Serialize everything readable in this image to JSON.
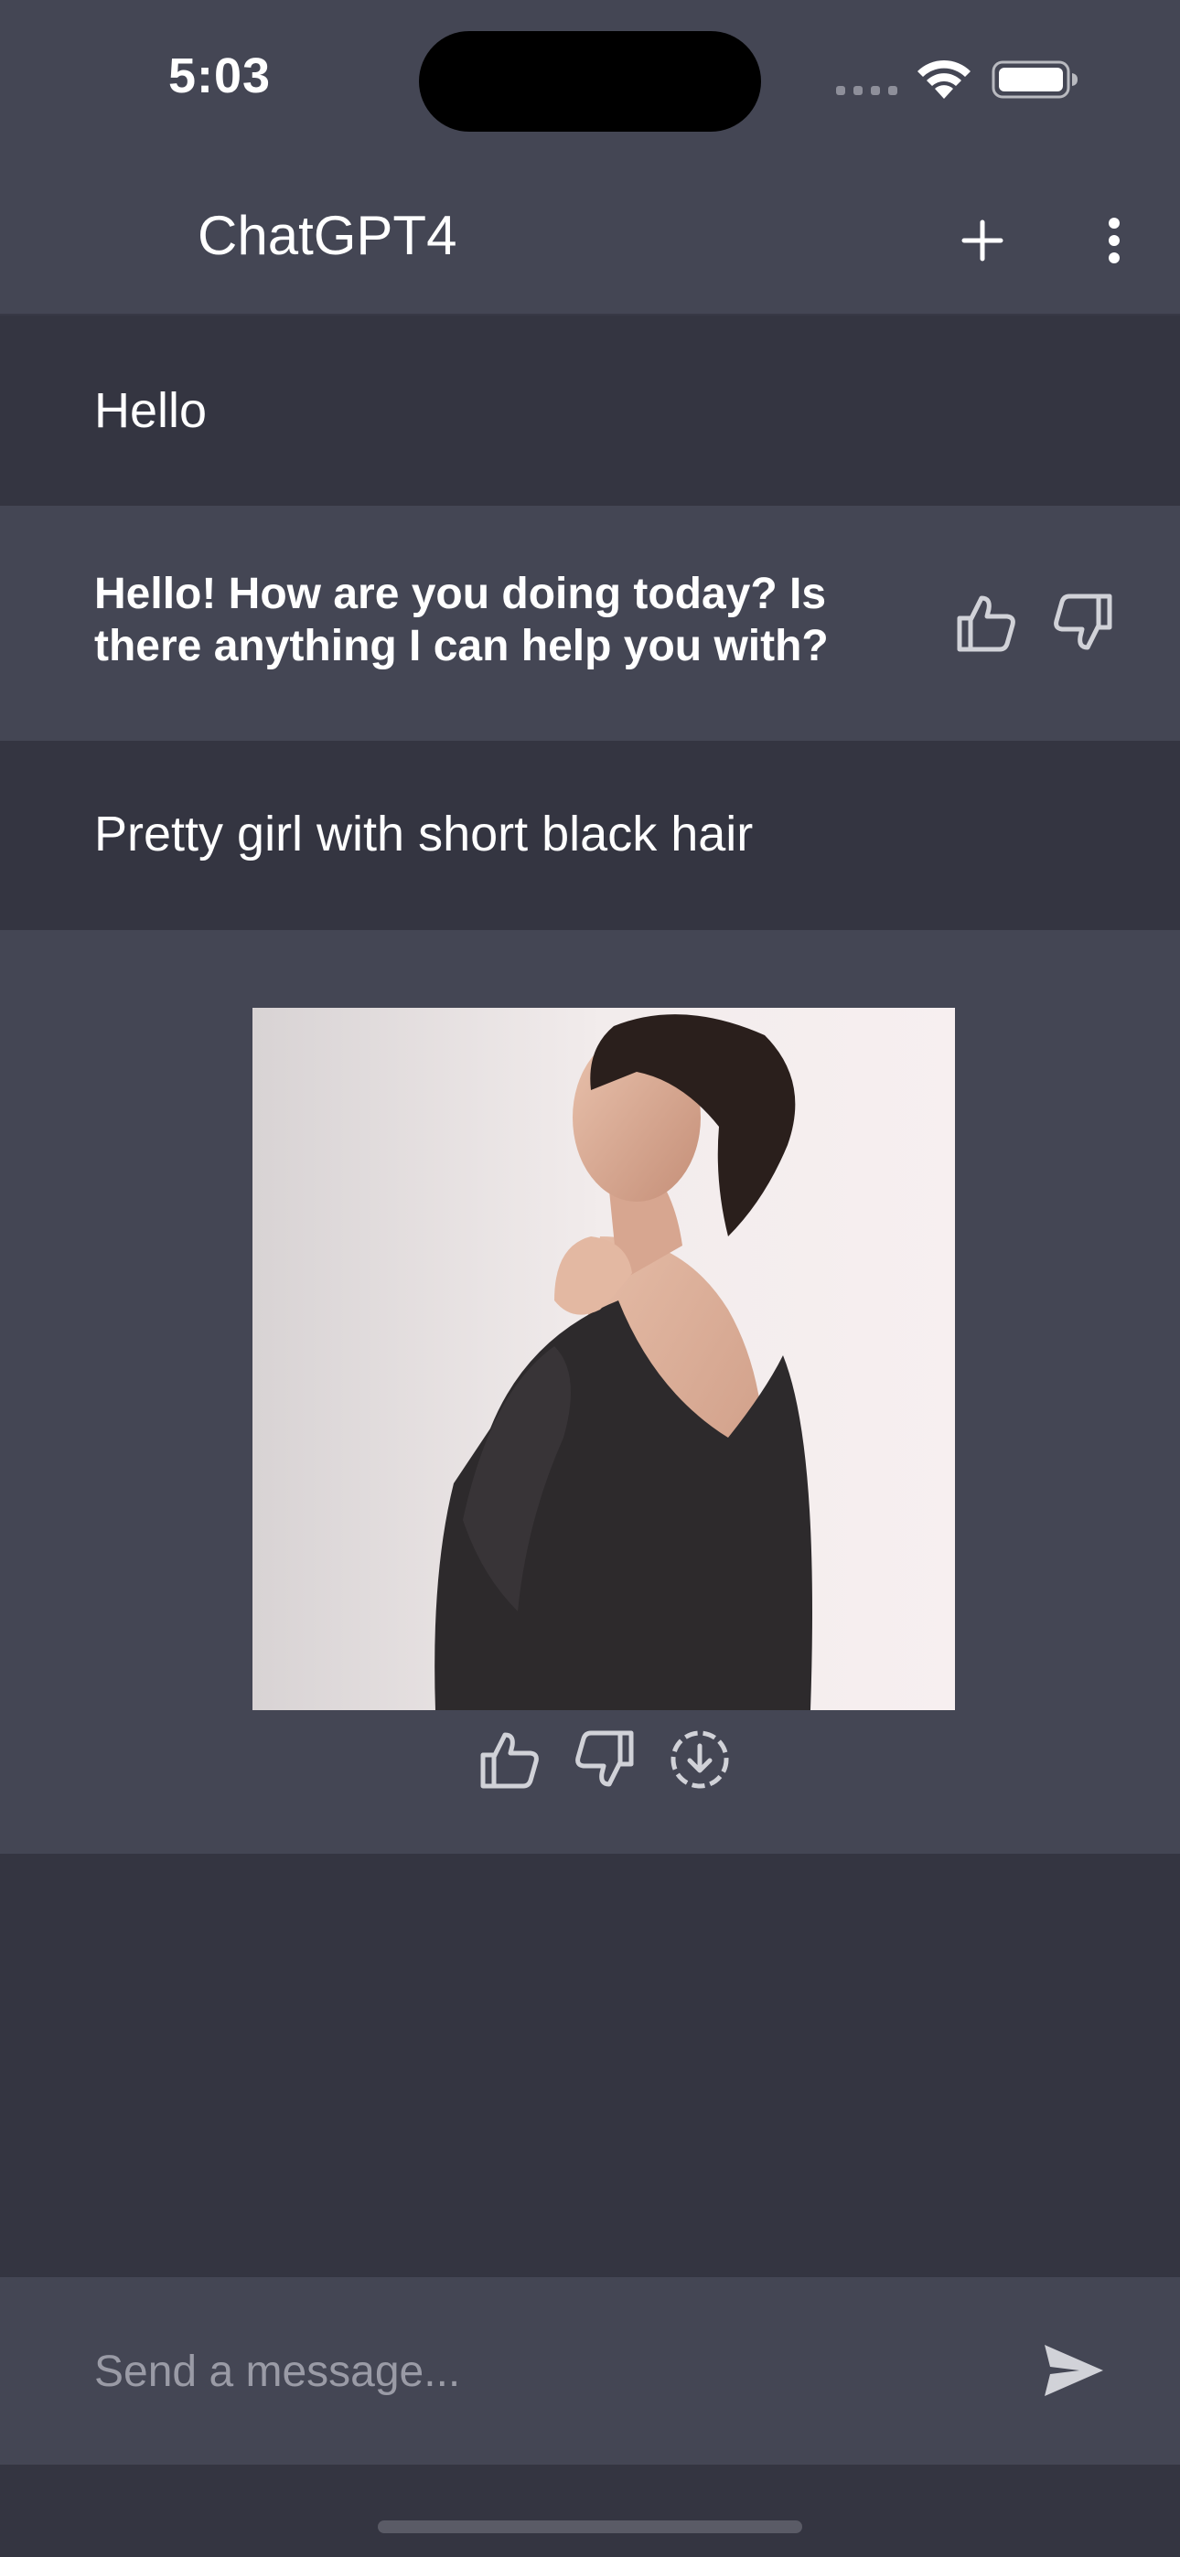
{
  "status_bar": {
    "time": "5:03",
    "icons": [
      "cellular-signal-icon",
      "wifi-icon",
      "battery-icon"
    ]
  },
  "app_bar": {
    "title": "ChatGPT4",
    "icons": [
      "plus-icon",
      "more-vertical-icon"
    ]
  },
  "messages": [
    {
      "role": "user",
      "text": "Hello"
    },
    {
      "role": "assistant",
      "text": "Hello! How are you doing today? Is there anything I can help you with?",
      "actions": [
        "thumbs-up-icon",
        "thumbs-down-icon"
      ]
    },
    {
      "role": "user",
      "text": "Pretty girl with short black hair"
    },
    {
      "role": "assistant",
      "type": "image",
      "actions": [
        "thumbs-up-icon",
        "thumbs-down-icon",
        "download-icon"
      ]
    }
  ],
  "composer": {
    "placeholder": "Send a message...",
    "value": "",
    "send_icon": "send-icon"
  },
  "colors": {
    "background": "#343541",
    "surface": "#444654",
    "text": "#ffffff",
    "icon": "#d1d2d8",
    "placeholder": "#9a9ba6"
  }
}
